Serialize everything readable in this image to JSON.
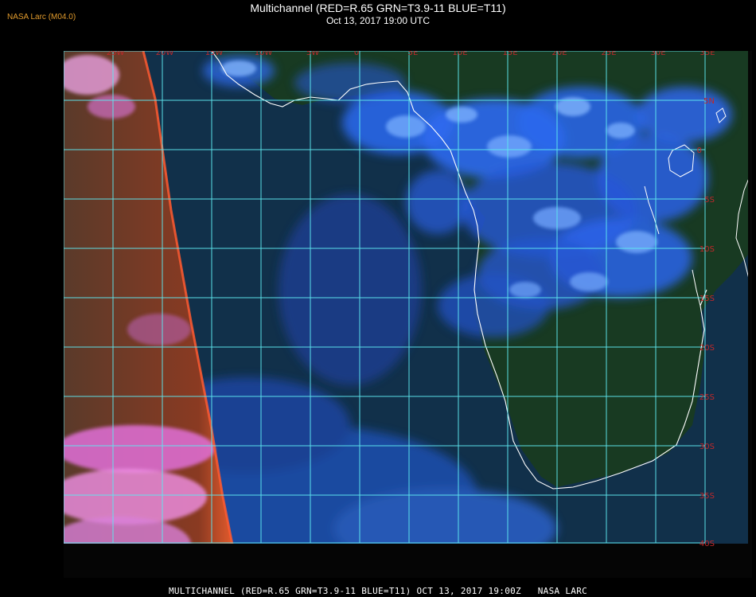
{
  "header": {
    "source_label": "NASA Larc (M04.0)",
    "title": "Multichannel (RED=R.65 GRN=T3.9-11 BLUE=T11)",
    "timestamp": "Oct 13, 2017 19:00 UTC"
  },
  "footer": {
    "caption": "MULTICHANNEL (RED=R.65 GRN=T3.9-11 BLUE=T11) OCT 13, 2017 19:00Z   NASA LARC"
  },
  "map": {
    "longitude_labels": [
      "25W",
      "20W",
      "15W",
      "10W",
      "5W",
      "0",
      "5E",
      "10E",
      "15E",
      "20E",
      "25E",
      "30E",
      "35E"
    ],
    "latitude_labels": [
      "5N",
      "0",
      "5S",
      "10S",
      "15S",
      "20S",
      "25S",
      "30S",
      "35S",
      "40S"
    ],
    "colors": {
      "ocean": "#11304a",
      "land": "#1b3f24",
      "grid": "#5ee8f0",
      "grid_label": "#c0282a",
      "coastline": "#ffffff",
      "cloud_high": "#2860e0",
      "cloud_low": "#6aa0ff",
      "swath_edge": "#d0503a",
      "swath_cloud": "#e070d0"
    }
  }
}
